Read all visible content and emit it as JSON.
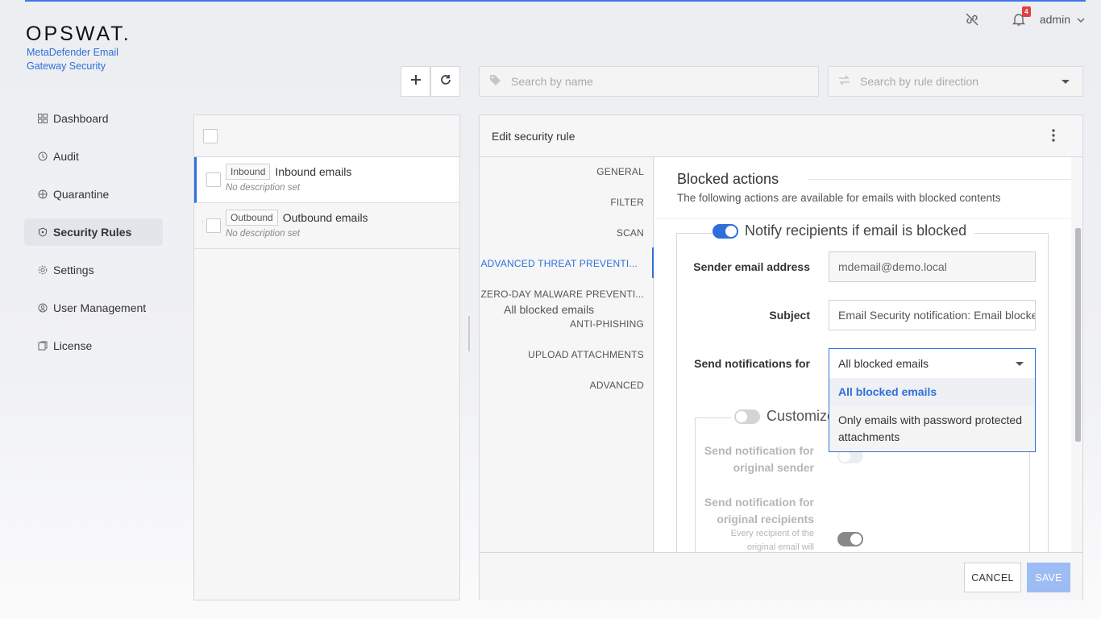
{
  "brand": {
    "logo": "OPSWAT.",
    "product": "MetaDefender Email Gateway Security"
  },
  "nav": [
    {
      "label": "Dashboard",
      "icon": "dashboard-icon"
    },
    {
      "label": "Audit",
      "icon": "audit-icon"
    },
    {
      "label": "Quarantine",
      "icon": "quarantine-icon"
    },
    {
      "label": "Security Rules",
      "icon": "shield-icon",
      "active": true
    },
    {
      "label": "Settings",
      "icon": "gear-icon"
    },
    {
      "label": "User Management",
      "icon": "users-icon"
    },
    {
      "label": "License",
      "icon": "license-icon"
    }
  ],
  "topbar": {
    "notifications": "4",
    "user": "admin"
  },
  "search": {
    "name_placeholder": "Search by name",
    "direction_placeholder": "Search by rule direction"
  },
  "rules": [
    {
      "tag": "Inbound",
      "name": "Inbound emails",
      "desc": "No description set",
      "active": true
    },
    {
      "tag": "Outbound",
      "name": "Outbound emails",
      "desc": "No description set",
      "active": false
    }
  ],
  "editor": {
    "title": "Edit security rule",
    "tabs": [
      "GENERAL",
      "FILTER",
      "SCAN",
      "ADVANCED THREAT PREVENTI...",
      "ZERO-DAY MALWARE PREVENTI...",
      "ANTI-PHISHING",
      "UPLOAD ATTACHMENTS",
      "ADVANCED"
    ],
    "active_tab": "ADVANCED THREAT PREVENTI...",
    "tab_overlay_text": "All blocked emails",
    "section_title": "Blocked actions",
    "section_sub": "The following actions are available for emails with blocked contents",
    "notify_label": "Notify recipients if email is blocked",
    "sender_label": "Sender email address",
    "sender_value": "mdemail@demo.local",
    "subject_label": "Subject",
    "subject_value": "Email Security notification: Email blocked",
    "send_for_label": "Send notifications for",
    "send_for_value": "All blocked emails",
    "options": [
      "All blocked emails",
      "Only emails with password protected attachments"
    ],
    "customize_label": "Customize",
    "orig_sender_label": "Send notification for original sender",
    "orig_recipients_label": "Send notification for original recipients",
    "orig_recipients_help": "Every recipient of the original email will",
    "cancel": "CANCEL",
    "save": "SAVE"
  },
  "colors": {
    "accent": "#2f6fdc",
    "badge": "#e04040"
  }
}
